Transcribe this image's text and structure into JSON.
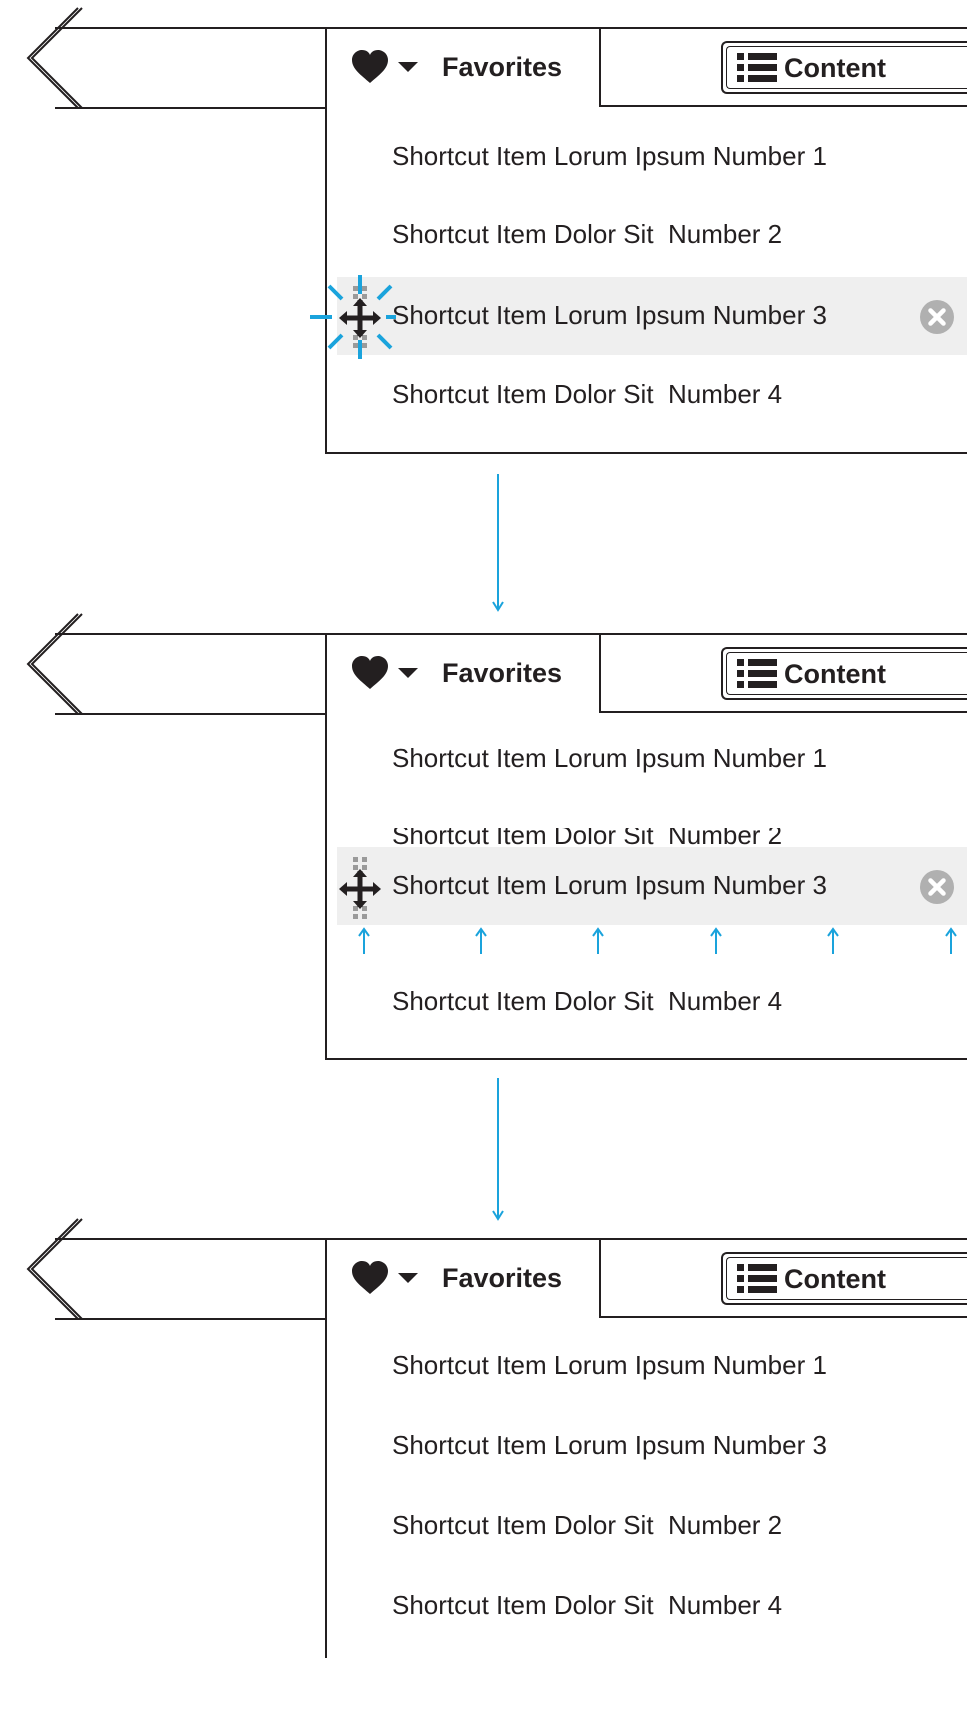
{
  "colors": {
    "ink": "#231f20",
    "accent": "#1aa3dc",
    "highlight_row": "#efefef",
    "remove_button": "#b0b0b0",
    "grip_dots": "#9a9a9a"
  },
  "icons": {
    "favorites_tab": [
      "heart-icon",
      "caret-down-icon"
    ],
    "content_tab": "list-icon",
    "remove": "close-circle-icon",
    "drag": "move-icon"
  },
  "frames": [
    {
      "step": 1,
      "favorites_label": "Favorites",
      "content_label": "Content",
      "items": [
        "Shortcut Item Lorum Ipsum Number 1",
        "Shortcut Item Dolor Sit  Number 2",
        "Shortcut Item Lorum Ipsum Number 3",
        "Shortcut Item Dolor Sit  Number 4"
      ],
      "grabbed_item": "Shortcut Item Lorum Ipsum Number 3"
    },
    {
      "step": 2,
      "favorites_label": "Favorites",
      "content_label": "Content",
      "items": [
        "Shortcut Item Lorum Ipsum Number 1",
        "Shortcut Item Dolor Sit  Number 2",
        "Shortcut Item Lorum Ipsum Number 3",
        "Shortcut Item Dolor Sit  Number 4"
      ],
      "dragged_item": "Shortcut Item Lorum Ipsum Number 3"
    },
    {
      "step": 3,
      "favorites_label": "Favorites",
      "content_label": "Content",
      "items": [
        "Shortcut Item Lorum Ipsum Number 1",
        "Shortcut Item Lorum Ipsum Number 3",
        "Shortcut Item Dolor Sit  Number 2",
        "Shortcut Item Dolor Sit  Number 4"
      ]
    }
  ]
}
